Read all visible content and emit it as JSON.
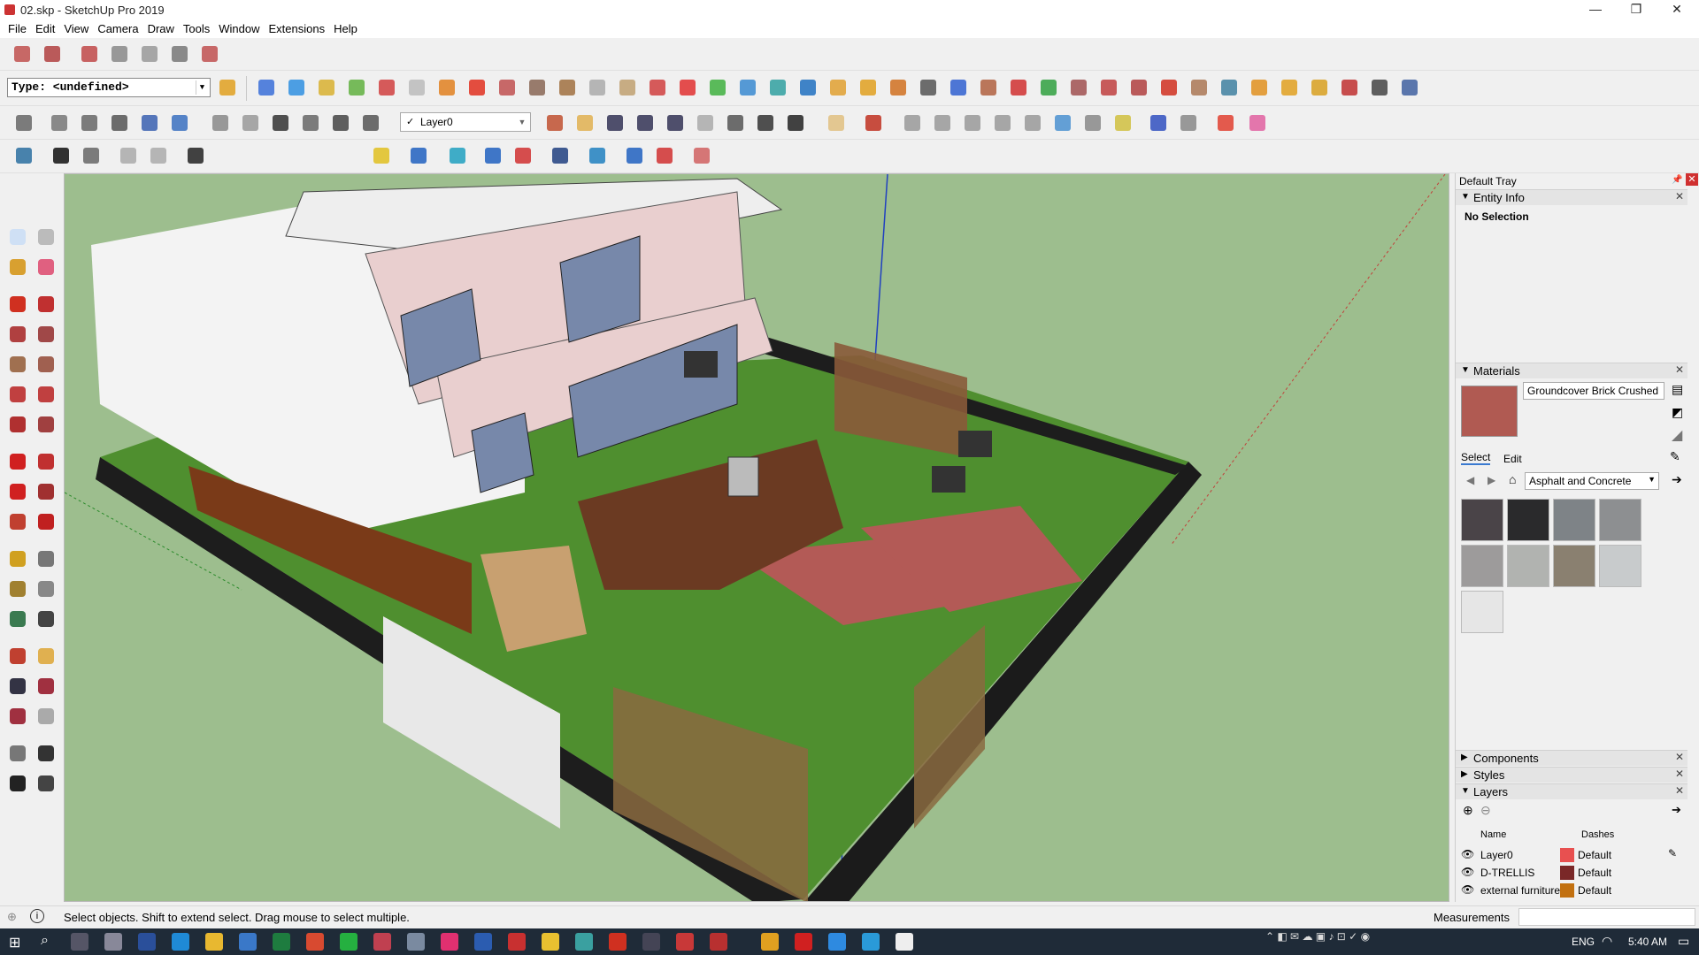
{
  "window": {
    "title": "02.skp - SketchUp Pro 2019",
    "minimize": "—",
    "maximize": "❐",
    "close": "✕"
  },
  "menu": [
    "File",
    "Edit",
    "View",
    "Camera",
    "Draw",
    "Tools",
    "Window",
    "Extensions",
    "Help"
  ],
  "toolbar": {
    "type_select": "Type: <undefined>",
    "layer_select": "Layer0"
  },
  "tray": {
    "title": "Default Tray",
    "entity_info": {
      "header": "Entity Info",
      "selection": "No Selection"
    },
    "materials": {
      "header": "Materials",
      "current_name": "Groundcover Brick Crushed",
      "current_color": "#b05a52",
      "tab_select": "Select",
      "tab_edit": "Edit",
      "library": "Asphalt and Concrete",
      "swatches": [
        "#4a4448",
        "#2a2a2c",
        "#7e8387",
        "#8d8f91",
        "#9d9b9b",
        "#b1b3b0",
        "#8a8070",
        "#c8cbcc",
        "#e6e6e6"
      ]
    },
    "components": "Components",
    "styles": "Styles",
    "layers": {
      "header": "Layers",
      "col_name": "Name",
      "col_dashes": "Dashes",
      "rows": [
        {
          "name": "Layer0",
          "color": "#e85050",
          "dashes": "Default"
        },
        {
          "name": "D-TRELLIS",
          "color": "#7a2828",
          "dashes": "Default"
        },
        {
          "name": "external furniture",
          "color": "#c27010",
          "dashes": "Default"
        }
      ]
    }
  },
  "status": {
    "message": "Select objects. Shift to extend select. Drag mouse to select multiple.",
    "measurements_label": "Measurements"
  },
  "taskbar": {
    "lang": "ENG",
    "time": "5:40 AM"
  }
}
